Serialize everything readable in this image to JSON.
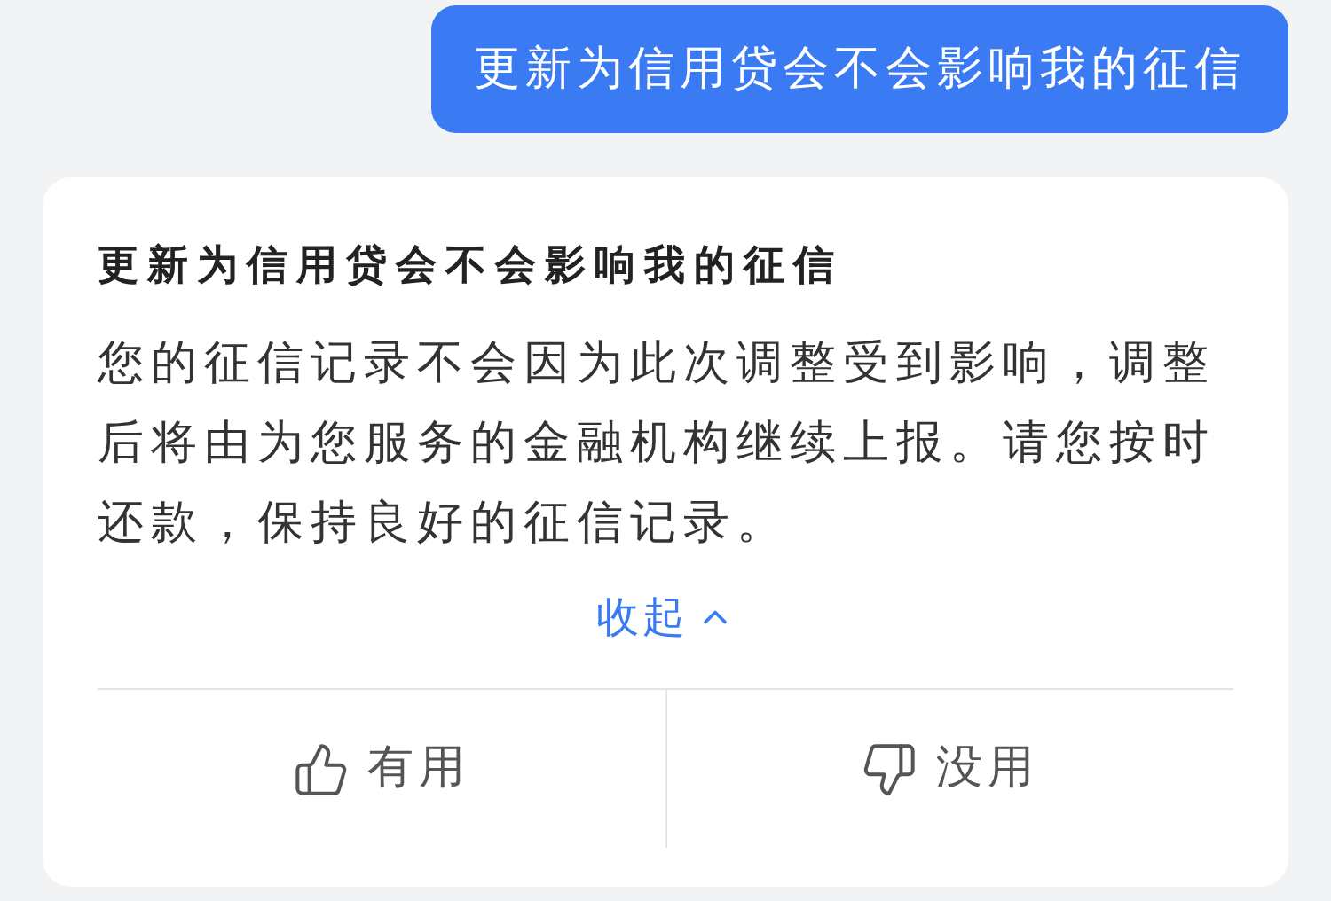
{
  "user_message": "更新为信用贷会不会影响我的征信",
  "answer": {
    "title": "更新为信用贷会不会影响我的征信",
    "body": "您的征信记录不会因为此次调整受到影响，调整后将由为您服务的金融机构继续上报。请您按时还款，保持良好的征信记录。",
    "collapse_label": "收起",
    "feedback": [
      {
        "kind": "like",
        "label": "有用"
      },
      {
        "kind": "dislike",
        "label": "没用"
      }
    ]
  }
}
